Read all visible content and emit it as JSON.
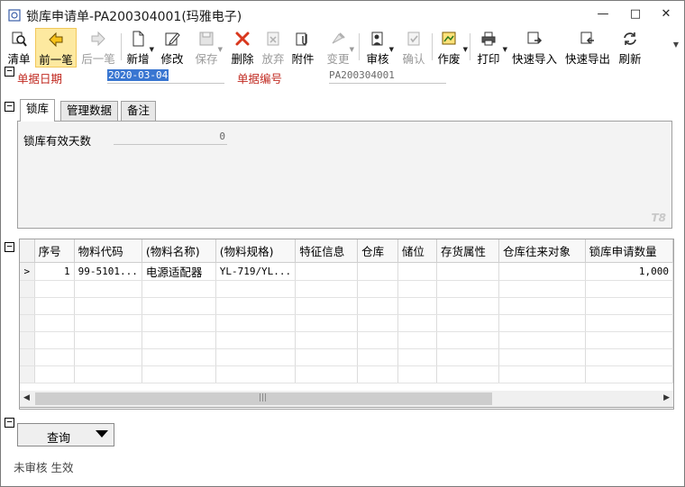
{
  "window": {
    "title": "锁库申请单-PA200304001(玛雅电子)",
    "minimize_glyph": "—",
    "maximize_glyph": "□",
    "close_glyph": "✕"
  },
  "toolbar": {
    "items": [
      {
        "label": "清单",
        "icon": "list-search-icon"
      },
      {
        "label": "前一笔",
        "icon": "arrow-left-icon"
      },
      {
        "label": "后一笔",
        "icon": "arrow-right-icon"
      },
      {
        "label": "新增",
        "icon": "new-document-icon"
      },
      {
        "label": "修改",
        "icon": "edit-icon"
      },
      {
        "label": "保存",
        "icon": "save-icon"
      },
      {
        "label": "删除",
        "icon": "delete-icon"
      },
      {
        "label": "放弃",
        "icon": "discard-icon"
      },
      {
        "label": "附件",
        "icon": "attachment-icon"
      },
      {
        "label": "变更",
        "icon": "change-icon"
      },
      {
        "label": "审核",
        "icon": "audit-icon"
      },
      {
        "label": "确认",
        "icon": "confirm-icon"
      },
      {
        "label": "作废",
        "icon": "void-icon"
      },
      {
        "label": "打印",
        "icon": "print-icon"
      },
      {
        "label": "快速导入",
        "icon": "quick-import-icon"
      },
      {
        "label": "快速导出",
        "icon": "quick-export-icon"
      },
      {
        "label": "刷新",
        "icon": "refresh-icon"
      }
    ]
  },
  "header": {
    "date_label": "单据日期",
    "date_value": "2020-03-04",
    "number_label": "单据编号",
    "number_value": "PA200304001"
  },
  "tabs": {
    "items": [
      "锁库",
      "管理数据",
      "备注"
    ],
    "active": "锁库",
    "lock_days_label": "锁库有效天数",
    "lock_days_value": "0",
    "watermark": "T8"
  },
  "grid": {
    "columns": [
      "序号",
      "物料代码",
      "(物料名称)",
      "(物料规格)",
      "特征信息",
      "仓库",
      "储位",
      "存货属性",
      "仓库往来对象",
      "锁库申请数量"
    ],
    "rows": [
      {
        "indicator": ">",
        "seq": "1",
        "code": "99-5101...",
        "name": "电源适配器",
        "spec": "YL-719/YL...",
        "feature": "",
        "warehouse": "",
        "location": "",
        "attr": "",
        "partner": "",
        "qty": "1,000"
      }
    ]
  },
  "footer": {
    "query_label": "查询",
    "status_text": "未审核 生效"
  },
  "colors": {
    "required_label": "#c0281f",
    "selection": "#3976d1"
  }
}
